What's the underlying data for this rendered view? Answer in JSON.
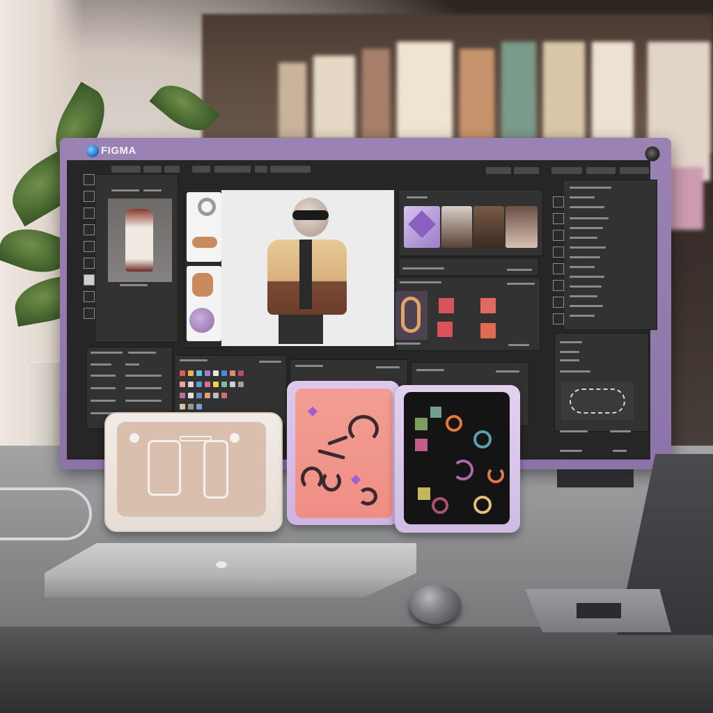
{
  "app": {
    "brand_name": "FIGMA"
  },
  "scene": {
    "objects": [
      "plant-in-glass",
      "monitor",
      "beige-tray",
      "pink-tray",
      "black-tray",
      "closed-laptop",
      "mouse",
      "open-laptop"
    ]
  },
  "icons": [
    "figma-logo-icon",
    "power-icon",
    "pen-tool-icon",
    "shape-tool-icon",
    "frame-tool-icon",
    "hand-tool-icon",
    "text-tool-icon"
  ],
  "colors": {
    "monitor_bezel": "#8d74a8",
    "screen_bg": "#262626",
    "panel_bg": "#323232",
    "canvas_bg": "#ececec",
    "tray_pink": "#ef8e85",
    "tray_black": "#141414",
    "tray_beige": "#d8bfae",
    "accent_purple": "#9b7dc9"
  }
}
